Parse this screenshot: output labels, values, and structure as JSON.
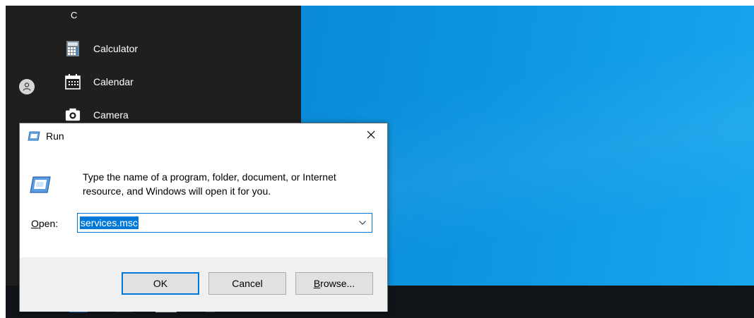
{
  "start_menu": {
    "letter_header": "C",
    "apps": [
      {
        "label": "Calculator",
        "icon": "calculator-icon"
      },
      {
        "label": "Calendar",
        "icon": "calendar-icon"
      },
      {
        "label": "Camera",
        "icon": "camera-icon"
      }
    ]
  },
  "run_dialog": {
    "title": "Run",
    "description": "Type the name of a program, folder, document, or Internet resource, and Windows will open it for you.",
    "open_label_mnemonic": "O",
    "open_label_rest": "pen:",
    "open_value": "services.msc",
    "buttons": {
      "ok": "OK",
      "cancel": "Cancel",
      "browse_mnemonic": "B",
      "browse_rest": "rowse..."
    }
  },
  "colors": {
    "accent": "#0078d7",
    "desktop": "#0d96e2",
    "start_menu": "#1f1f1f",
    "button_area": "#f0f0f0"
  }
}
